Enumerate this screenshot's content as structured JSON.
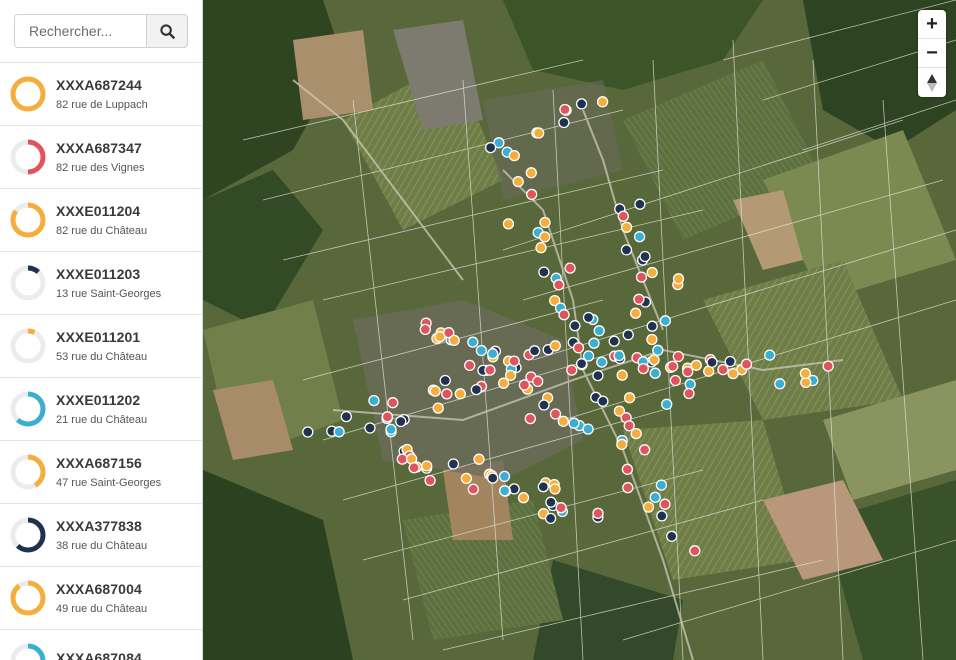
{
  "search": {
    "placeholder": "Rechercher..."
  },
  "colors": {
    "orange": "#f5ad3b",
    "red": "#e0545e",
    "navy": "#1f3350",
    "cyan": "#3aafd0",
    "track": "#ececec"
  },
  "icons": {
    "search": "magnifier-icon",
    "zoom_in": "plus-icon",
    "zoom_out": "minus-icon",
    "compass": "compass-arrow-icon"
  },
  "zoom": {
    "in_label": "+",
    "out_label": "−"
  },
  "items": [
    {
      "code": "XXXA687244",
      "address": "82 rue de Luppach",
      "color": "orange",
      "fraction": 1.0
    },
    {
      "code": "XXXA687347",
      "address": "82 rue des Vignes",
      "color": "red",
      "fraction": 0.5
    },
    {
      "code": "XXXE011204",
      "address": "82 rue du Château",
      "color": "orange",
      "fraction": 0.85
    },
    {
      "code": "XXXE011203",
      "address": "13 rue Saint-Georges",
      "color": "navy",
      "fraction": 0.12
    },
    {
      "code": "XXXE011201",
      "address": "53 rue du Château",
      "color": "orange",
      "fraction": 0.07
    },
    {
      "code": "XXXE011202",
      "address": "21 rue du Château",
      "color": "cyan",
      "fraction": 0.62
    },
    {
      "code": "XXXA687156",
      "address": "47 rue Saint-Georges",
      "color": "orange",
      "fraction": 0.42
    },
    {
      "code": "XXXA377838",
      "address": "38 rue du Château",
      "color": "navy",
      "fraction": 0.62
    },
    {
      "code": "XXXA687004",
      "address": "49 rue du Château",
      "color": "orange",
      "fraction": 0.9
    },
    {
      "code": "XXXA687084",
      "address": "",
      "color": "cyan",
      "fraction": 0.3
    }
  ]
}
